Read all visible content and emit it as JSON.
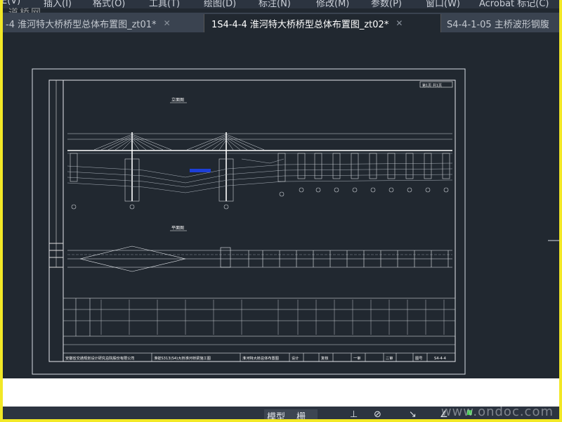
{
  "menubar": {
    "items": [
      "E(V)",
      "插入(I)",
      "格式(O)",
      "工具(T)",
      "绘图(D)",
      "标注(N)",
      "修改(M)",
      "参数(P)",
      "窗口(W)",
      "Acrobat 标记(C)"
    ]
  },
  "watermark_top": "道桥网",
  "tabs": [
    {
      "label": "-4 淮河特大桥桥型总体布置图_zt01*",
      "active": false
    },
    {
      "label": "1S4-4-4 淮河特大桥桥型总体布置图_zt02*",
      "active": true
    },
    {
      "label": "S4-4-1-05 主桥波形钢腹",
      "active": false
    }
  ],
  "drawing": {
    "sheet_no_top": "第1页 共1页",
    "elevation_title": "立面图",
    "plan_title": "平面图",
    "title_block": {
      "company": "安徽省交通规划设计研究总院股份有限公司",
      "project": "淮蚌S313(S4)大桥淮河桥梁施工图",
      "drawing_name": "淮河特大桥总体布置图",
      "design_label": "设计",
      "check_label": "复核",
      "review_label": "审核",
      "level1": "一审",
      "level2": "二审",
      "date_label": "图号",
      "drawing_no": "S4-4-4"
    }
  },
  "bottombar": {
    "model_label": "模型",
    "grid_label": "栅",
    "watermark": "www.ondoc.com"
  }
}
